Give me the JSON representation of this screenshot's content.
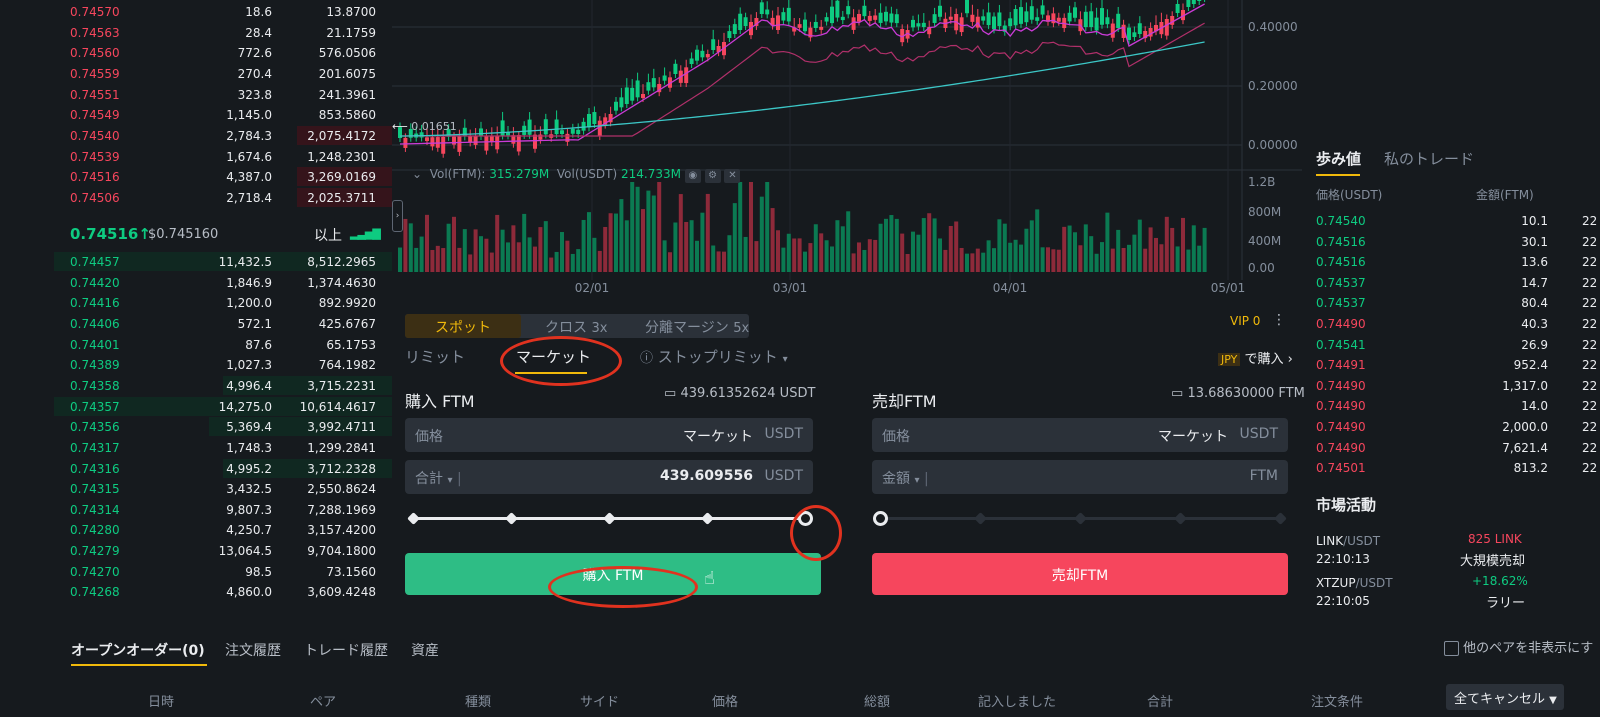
{
  "orderbook": {
    "asks": [
      {
        "price": "0.74570",
        "amount": "18.6",
        "total": "13.8700",
        "depth": 0.0
      },
      {
        "price": "0.74563",
        "amount": "28.4",
        "total": "21.1759",
        "depth": 0.0
      },
      {
        "price": "0.74560",
        "amount": "772.6",
        "total": "576.0506",
        "depth": 0.0
      },
      {
        "price": "0.74559",
        "amount": "270.4",
        "total": "201.6075",
        "depth": 0.0
      },
      {
        "price": "0.74551",
        "amount": "323.8",
        "total": "241.3961",
        "depth": 0.0
      },
      {
        "price": "0.74549",
        "amount": "1,145.0",
        "total": "853.5860",
        "depth": 0.0
      },
      {
        "price": "0.74540",
        "amount": "2,784.3",
        "total": "2,075.4172",
        "depth": 0.28
      },
      {
        "price": "0.74539",
        "amount": "1,674.6",
        "total": "1,248.2301",
        "depth": 0.0
      },
      {
        "price": "0.74516",
        "amount": "4,387.0",
        "total": "3,269.0169",
        "depth": 0.28
      },
      {
        "price": "0.74506",
        "amount": "2,718.4",
        "total": "2,025.3711",
        "depth": 0.28
      }
    ],
    "mid_price": "0.74516",
    "mid_arrow": "↑",
    "mid_usd": "$0.745160",
    "more_label": "以上",
    "bids": [
      {
        "price": "0.74457",
        "amount": "11,432.5",
        "total": "8,512.2965",
        "depth": 1.0
      },
      {
        "price": "0.74420",
        "amount": "1,846.9",
        "total": "1,374.4630",
        "depth": 0.0
      },
      {
        "price": "0.74416",
        "amount": "1,200.0",
        "total": "892.9920",
        "depth": 0.0
      },
      {
        "price": "0.74406",
        "amount": "572.1",
        "total": "425.6767",
        "depth": 0.0
      },
      {
        "price": "0.74401",
        "amount": "87.6",
        "total": "65.1753",
        "depth": 0.0
      },
      {
        "price": "0.74389",
        "amount": "1,027.3",
        "total": "764.1982",
        "depth": 0.0
      },
      {
        "price": "0.74358",
        "amount": "4,996.4",
        "total": "3,715.2231",
        "depth": 0.5
      },
      {
        "price": "0.74357",
        "amount": "14,275.0",
        "total": "10,614.4617",
        "depth": 1.0
      },
      {
        "price": "0.74356",
        "amount": "5,369.4",
        "total": "3,992.4711",
        "depth": 0.54
      },
      {
        "price": "0.74317",
        "amount": "1,748.3",
        "total": "1,299.2841",
        "depth": 0.0
      },
      {
        "price": "0.74316",
        "amount": "4,995.2",
        "total": "3,712.2328",
        "depth": 0.5
      },
      {
        "price": "0.74315",
        "amount": "3,432.5",
        "total": "2,550.8624",
        "depth": 0.0
      },
      {
        "price": "0.74314",
        "amount": "9,807.3",
        "total": "7,288.1969",
        "depth": 0.0
      },
      {
        "price": "0.74280",
        "amount": "4,250.7",
        "total": "3,157.4200",
        "depth": 0.0
      },
      {
        "price": "0.74279",
        "amount": "13,064.5",
        "total": "9,704.1800",
        "depth": 0.0
      },
      {
        "price": "0.74270",
        "amount": "98.5",
        "total": "73.1560",
        "depth": 0.0
      },
      {
        "price": "0.74268",
        "amount": "4,860.0",
        "total": "3,609.4248",
        "depth": 0.0
      }
    ]
  },
  "chart": {
    "price_ticks": [
      "0.40000",
      "0.20000",
      "0.00000"
    ],
    "low_marker": "0.01651",
    "vol_label_ftm": "Vol(FTM):",
    "vol_value_ftm": "315.279M",
    "vol_label_usdt": "Vol(USDT)",
    "vol_value_usdt": "214.733M",
    "vol_ticks": [
      "1.2B",
      "800M",
      "400M",
      "0.00"
    ],
    "date_ticks": [
      "02/01",
      "03/01",
      "04/01",
      "05/01"
    ]
  },
  "panel": {
    "mode_tabs": [
      {
        "label": "スポット",
        "mult": ""
      },
      {
        "label": "クロス",
        "mult": "3x"
      },
      {
        "label": "分離マージン",
        "mult": "5x"
      }
    ],
    "vip": "VIP 0",
    "order_types": [
      "リミット",
      "マーケット",
      "ストップリミット"
    ],
    "jpy_badge": "JPY",
    "jpy_buy": "で購入",
    "buy": {
      "title": "購入 FTM",
      "balance": "439.61352624 USDT",
      "price_label": "価格",
      "price_value": "マーケット",
      "price_unit": "USDT",
      "total_label": "合計",
      "total_value": "439.609556",
      "total_unit": "USDT",
      "slider_pct": 1.0,
      "button": "購入 FTM"
    },
    "sell": {
      "title": "売却FTM",
      "balance": "13.68630000 FTM",
      "price_label": "価格",
      "price_value": "マーケット",
      "price_unit": "USDT",
      "amount_label": "金額",
      "amount_unit": "FTM",
      "slider_pct": 0.0,
      "button": "売却FTM"
    }
  },
  "trades": {
    "tabs": [
      "歩み値",
      "私のトレード"
    ],
    "headers": [
      "価格(USDT)",
      "金額(FTM)"
    ],
    "rows": [
      {
        "price": "0.74540",
        "amount": "10.1",
        "time": "22",
        "side": "buy"
      },
      {
        "price": "0.74516",
        "amount": "30.1",
        "time": "22",
        "side": "buy"
      },
      {
        "price": "0.74516",
        "amount": "13.6",
        "time": "22",
        "side": "buy"
      },
      {
        "price": "0.74537",
        "amount": "14.7",
        "time": "22",
        "side": "buy"
      },
      {
        "price": "0.74537",
        "amount": "80.4",
        "time": "22",
        "side": "buy"
      },
      {
        "price": "0.74490",
        "amount": "40.3",
        "time": "22",
        "side": "sell"
      },
      {
        "price": "0.74541",
        "amount": "26.9",
        "time": "22",
        "side": "buy"
      },
      {
        "price": "0.74491",
        "amount": "952.4",
        "time": "22",
        "side": "sell"
      },
      {
        "price": "0.74490",
        "amount": "1,317.0",
        "time": "22",
        "side": "sell"
      },
      {
        "price": "0.74490",
        "amount": "14.0",
        "time": "22",
        "side": "sell"
      },
      {
        "price": "0.74490",
        "amount": "2,000.0",
        "time": "22",
        "side": "sell"
      },
      {
        "price": "0.74490",
        "amount": "7,621.4",
        "time": "22",
        "side": "sell"
      },
      {
        "price": "0.74501",
        "amount": "813.2",
        "time": "22",
        "side": "sell"
      }
    ]
  },
  "market": {
    "title": "市場活動",
    "items": [
      {
        "pair": "LINK",
        "quote": "/USDT",
        "time": "22:10:13",
        "value": "825 LINK",
        "desc": "大規模売却",
        "color": "#f6465d"
      },
      {
        "pair": "XTZUP",
        "quote": "/USDT",
        "time": "22:10:05",
        "value": "+18.62%",
        "desc": "ラリー",
        "color": "#0ecb81"
      }
    ]
  },
  "bottom": {
    "tabs": [
      "オープンオーダー(0)",
      "注文履歴",
      "トレード履歴",
      "資産"
    ],
    "hide_pairs": "他のペアを非表示にす",
    "columns": [
      "日時",
      "ペア",
      "種類",
      "サイド",
      "価格",
      "総額",
      "記入しました",
      "合計",
      "注文条件"
    ],
    "cancel_all": "全てキャンセル"
  }
}
